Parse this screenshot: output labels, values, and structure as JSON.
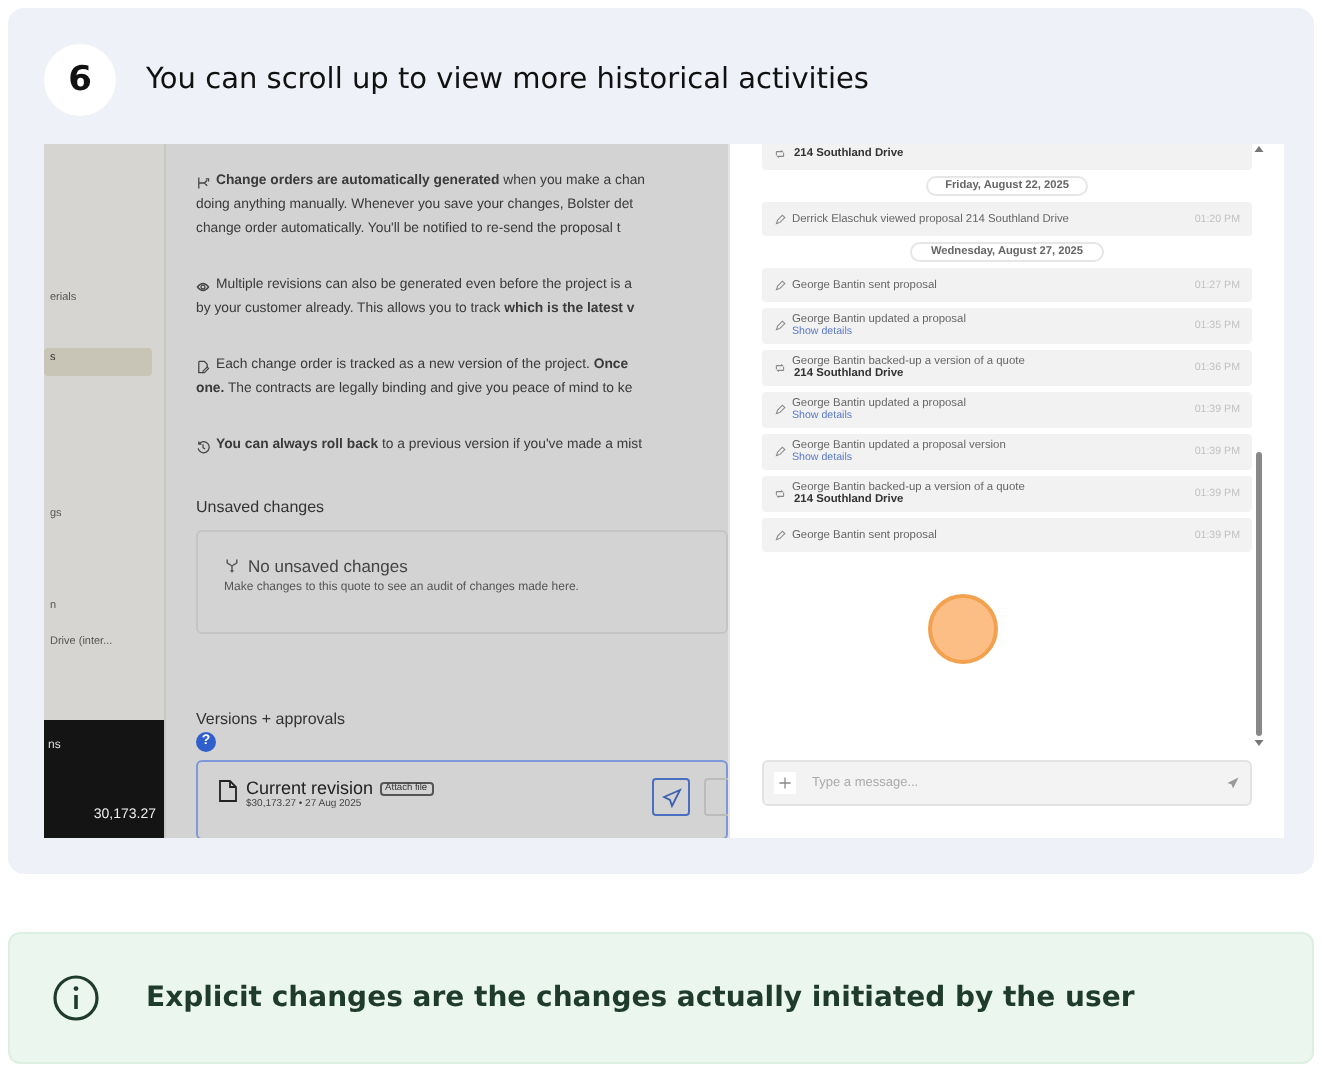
{
  "step": {
    "number": "6",
    "text": "You can scroll up to view more historical activities"
  },
  "screenshot": {
    "sidebar": {
      "items": [
        {
          "text": "erials",
          "selected": false
        },
        {
          "text": "s",
          "selected": true
        },
        {
          "text": "gs",
          "selected": false
        },
        {
          "text": "n",
          "selected": false
        },
        {
          "text": "Drive (inter...",
          "selected": false
        }
      ],
      "summary": {
        "label": "ns",
        "value": "30,173.27"
      }
    },
    "paragraphs": [
      {
        "kind": "branch",
        "lines": [
          "**Change orders are automatically generated** when you make a chan",
          "doing anything manually. Whenever you save your changes, Bolster det",
          "change order automatically. You'll be notified to re-send the proposal t"
        ]
      },
      {
        "kind": "eye",
        "lines": [
          "Multiple revisions can also be generated even before the project is a",
          "by your customer already. This allows you to track **which is the latest v**"
        ]
      },
      {
        "kind": "document",
        "lines": [
          "Each change order is tracked as a new version of the project. **Once**",
          "**one.** The contracts are legally binding and give you peace of mind to ke"
        ]
      },
      {
        "kind": "history",
        "lines": [
          "**You can always roll back** to a previous version if you've made a mist"
        ]
      }
    ],
    "unsaved": {
      "heading": "Unsaved changes",
      "title": "No unsaved changes",
      "text": "Make changes to this quote to see an audit of changes made here."
    },
    "versions": {
      "heading": "Versions + approvals",
      "help": "?",
      "current": {
        "title": "Current revision",
        "badge": "Attach file",
        "meta": "$30,173.27 • 27 Aug 2025"
      }
    },
    "activity": [
      {
        "kind": "backup",
        "detail": "214 Southland Drive"
      },
      {
        "kind": "date",
        "text": "Friday, August 22, 2025"
      },
      {
        "kind": "edit",
        "text": "Derrick Elaschuk viewed proposal 214 Southland Drive",
        "time": "01:20 PM"
      },
      {
        "kind": "date",
        "text": "Wednesday, August 27, 2025"
      },
      {
        "kind": "edit",
        "text": "George Bantin sent proposal",
        "time": "01:27 PM"
      },
      {
        "kind": "edit",
        "text": "George Bantin updated a proposal",
        "link": "Show details",
        "time": "01:35 PM"
      },
      {
        "kind": "backup",
        "text": "George Bantin backed-up a version of a quote",
        "detail": "214 Southland Drive",
        "time": "01:36 PM"
      },
      {
        "kind": "edit",
        "text": "George Bantin updated a proposal",
        "link": "Show details",
        "time": "01:39 PM"
      },
      {
        "kind": "edit",
        "text": "George Bantin updated a proposal version",
        "link": "Show details",
        "time": "01:39 PM"
      },
      {
        "kind": "backup",
        "text": "George Bantin backed-up a version of a quote",
        "detail": "214 Southland Drive",
        "time": "01:39 PM"
      },
      {
        "kind": "edit",
        "text": "George Bantin sent proposal",
        "time": "01:39 PM"
      }
    ],
    "message": {
      "placeholder": "Type a message..."
    }
  },
  "tip": {
    "text": "Explicit changes are the changes actually initiated by the user"
  }
}
